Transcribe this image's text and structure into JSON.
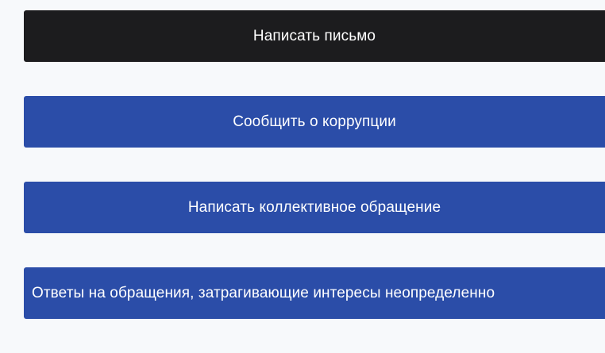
{
  "buttons": [
    {
      "label": "Написать письмо",
      "color": "#1c1c1e"
    },
    {
      "label": "Сообщить о коррупции",
      "color": "#2b4da8"
    },
    {
      "label": "Написать коллективное обращение",
      "color": "#2b4da8"
    },
    {
      "label": "Ответы на обращения, затрагивающие интересы неопределенно",
      "color": "#2b4da8"
    }
  ]
}
